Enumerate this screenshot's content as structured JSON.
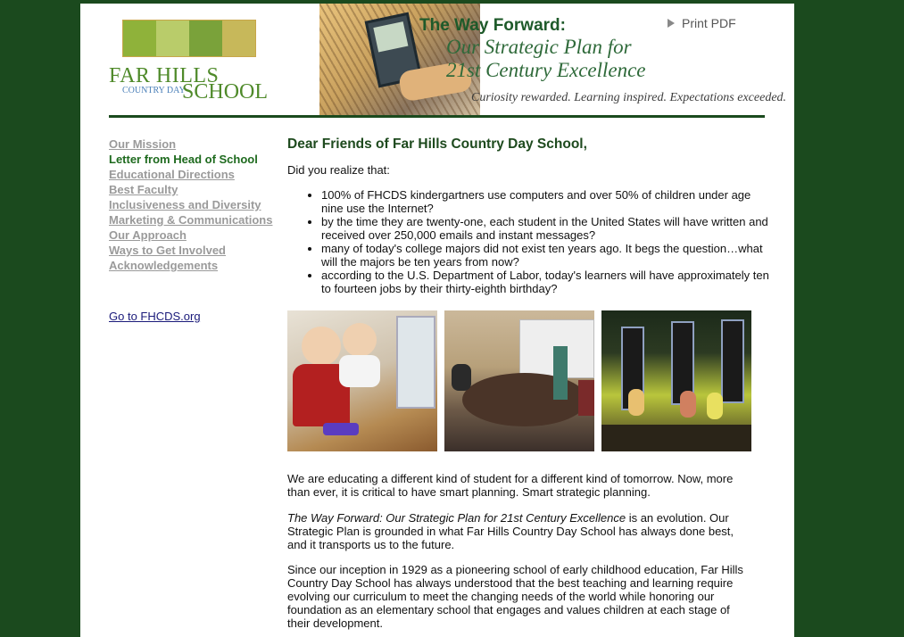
{
  "header": {
    "logo": {
      "line1": "FAR HILLS",
      "line2": "COUNTRY DAY",
      "line3": "SCHOOL"
    },
    "title": "The Way Forward:",
    "subtitle_line1": "Our Strategic Plan for",
    "subtitle_line2": "21st Century Excellence",
    "tagline": "Curiosity rewarded. Learning inspired. Expectations exceeded.",
    "print_label": "Print PDF"
  },
  "sidebar": {
    "items": [
      {
        "label": "Our Mission"
      },
      {
        "label": "Letter from Head of School"
      },
      {
        "label": "Educational Directions"
      },
      {
        "label": "Best Faculty"
      },
      {
        "label": "Inclusiveness and Diversity"
      },
      {
        "label": "Marketing & Communications"
      },
      {
        "label": "Our Approach"
      },
      {
        "label": "Ways to Get Involved"
      },
      {
        "label": "Acknowledgements"
      }
    ],
    "goto_label": "Go to FHCDS.org"
  },
  "main": {
    "heading": "Dear Friends of Far Hills Country Day School,",
    "intro": "Did you realize that:",
    "bullets": [
      "100% of FHCDS kindergartners use computers and over 50% of children under age nine use the Internet?",
      "by the time they are twenty-one, each student in the United States will have written and received over 250,000 emails and instant messages?",
      "many of today's college majors did not exist ten years ago. It begs the question…what will the majors be ten years from now?",
      "according to the U.S. Department of Labor, today's learners will have approximately ten to fourteen jobs by their thirty-eighth birthday?"
    ],
    "para1": "We are educating a different kind of student for a different kind of tomorrow. Now, more than ever, it is critical to have smart planning. Smart strategic planning.",
    "para2_em": "The Way Forward: Our Strategic Plan for 21st Century Excellence",
    "para2_rest": " is an evolution. Our Strategic Plan is grounded in what Far Hills Country Day School has always done best, and it transports us to the future.",
    "para3": "Since our inception in 1929 as a pioneering school of early childhood education, Far Hills Country Day School has always understood that the best teaching and learning require evolving our curriculum to meet the changing needs of the world while honoring our foundation as an elementary school that engages and values children at each stage of their development."
  },
  "colors": {
    "background": "#1b4a1e",
    "heading_green": "#1e4a1e",
    "active_nav": "#1e6a1e",
    "inactive_nav": "#9a9a9a",
    "logo_green": "#4f8a2a"
  }
}
